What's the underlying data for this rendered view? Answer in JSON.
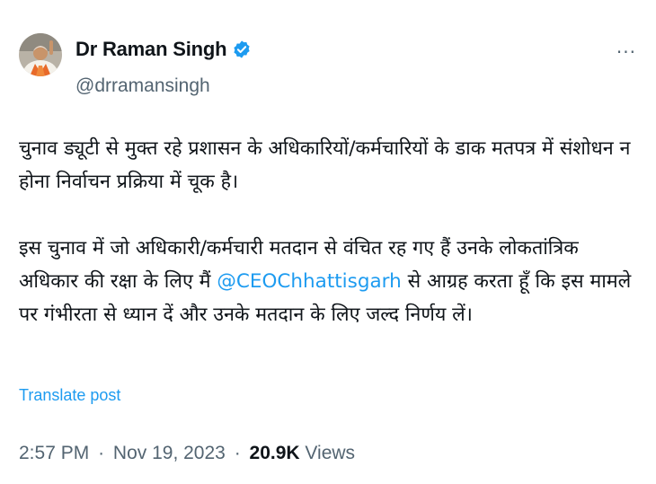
{
  "author": {
    "name": "Dr Raman Singh",
    "handle": "@drramansingh"
  },
  "more_label": "···",
  "post": {
    "paragraph1": "चुनाव ड्यूटी से मुक्त रहे प्रशासन के अधिकारियों/कर्मचारियों के डाक मतपत्र में संशोधन न होना निर्वाचन प्रक्रिया में चूक है।",
    "paragraph2_before": "इस चुनाव में जो अधिकारी/कर्मचारी मतदान से वंचित रह गए हैं उनके लोकतांत्रिक अधिकार की रक्षा के लिए मैं ",
    "mention": "@CEOChhattisgarh",
    "paragraph2_after": " से आग्रह करता हूँ कि इस मामले पर गंभीरता से ध्यान दें और उनके मतदान के लिए जल्द निर्णय लें।"
  },
  "translate_label": "Translate post",
  "meta": {
    "time": "2:57 PM",
    "date": "Nov 19, 2023",
    "separator": "·",
    "views_count": "20.9K",
    "views_label": "Views"
  },
  "colors": {
    "accent": "#1d9bf0",
    "secondary_text": "#536471",
    "primary_text": "#0f1419"
  }
}
